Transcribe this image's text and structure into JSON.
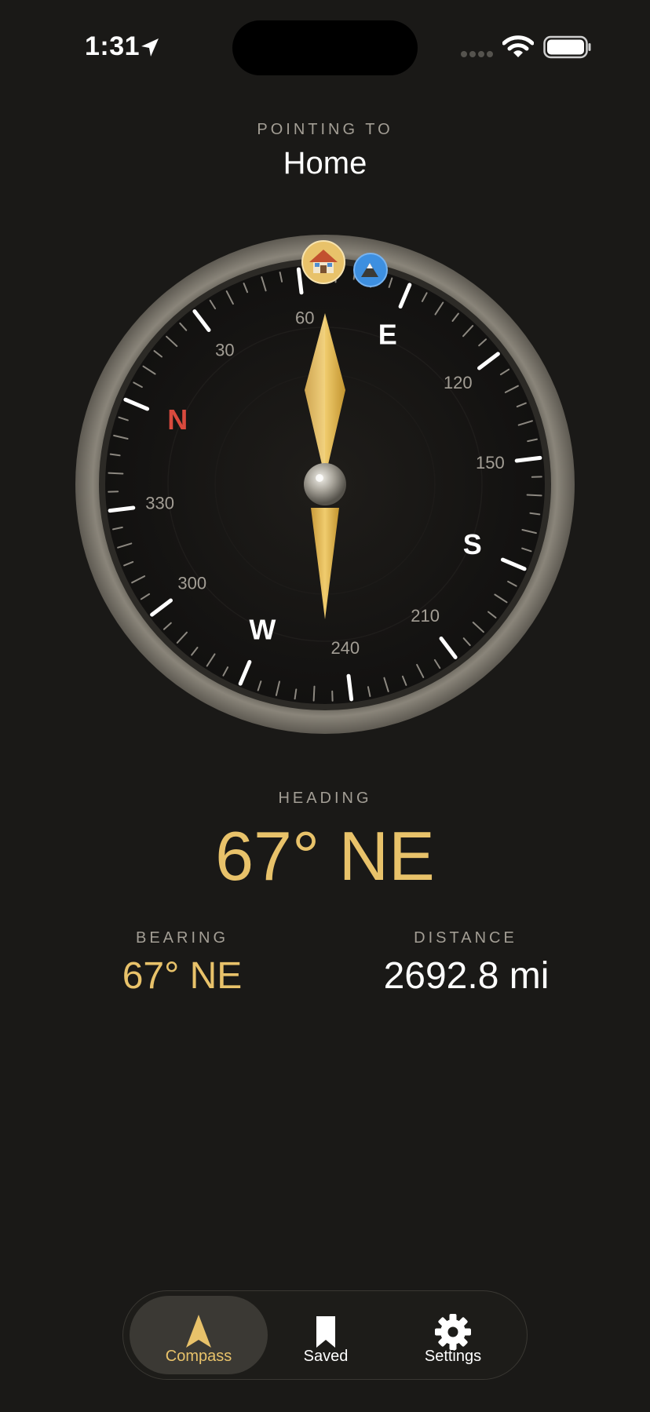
{
  "status_bar": {
    "time": "1:31"
  },
  "header": {
    "pointing_label": "POINTING TO",
    "destination": "Home"
  },
  "compass": {
    "cardinals": {
      "n": "N",
      "e": "E",
      "s": "S",
      "w": "W"
    },
    "degree_labels": [
      "30",
      "60",
      "120",
      "150",
      "210",
      "240",
      "300",
      "330"
    ],
    "markers": [
      {
        "name": "home",
        "icon": "house-icon",
        "color": "#e8c26a"
      },
      {
        "name": "mountain",
        "icon": "mountain-icon",
        "color": "#3d8fe0"
      }
    ],
    "colors": {
      "north": "#d94a3d",
      "needle": "#e8c26a"
    }
  },
  "readouts": {
    "heading_label": "HEADING",
    "heading_value": "67° NE",
    "bearing_label": "BEARING",
    "bearing_value": "67° NE",
    "distance_label": "DISTANCE",
    "distance_value": "2692.8 mi"
  },
  "tabs": [
    {
      "label": "Compass",
      "icon": "compass-arrow-icon",
      "active": true
    },
    {
      "label": "Saved",
      "icon": "bookmark-icon",
      "active": false
    },
    {
      "label": "Settings",
      "icon": "gear-icon",
      "active": false
    }
  ],
  "colors": {
    "accent": "#e8c26a",
    "background": "#1a1917",
    "muted": "#a39e95"
  }
}
